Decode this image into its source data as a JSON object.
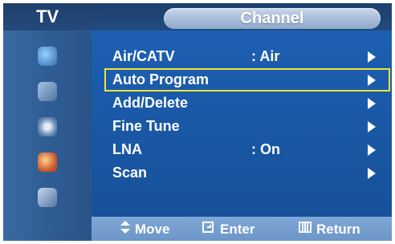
{
  "sidebar": {
    "title": "TV",
    "icons": [
      {
        "name": "picture-icon",
        "color": "#4a7fb8"
      },
      {
        "name": "sound-icon",
        "color": "#5b82a8"
      },
      {
        "name": "channel-icon",
        "color": "#6b8fb4"
      },
      {
        "name": "setup-icon",
        "color": "#c26a3d"
      },
      {
        "name": "input-icon",
        "color": "#5674a1"
      }
    ]
  },
  "header": {
    "title": "Channel"
  },
  "menu": {
    "items": [
      {
        "label": "Air/CATV",
        "value": ":  Air"
      },
      {
        "label": "Auto Program",
        "value": ""
      },
      {
        "label": "Add/Delete",
        "value": ""
      },
      {
        "label": "Fine Tune",
        "value": ""
      },
      {
        "label": "LNA",
        "value": ":  On"
      },
      {
        "label": "Scan",
        "value": ""
      }
    ],
    "selected_index": 1
  },
  "footer": {
    "move": "Move",
    "enter": "Enter",
    "return": "Return"
  },
  "colors": {
    "selection": "#f0e13a",
    "panel": "#1f61b6"
  }
}
